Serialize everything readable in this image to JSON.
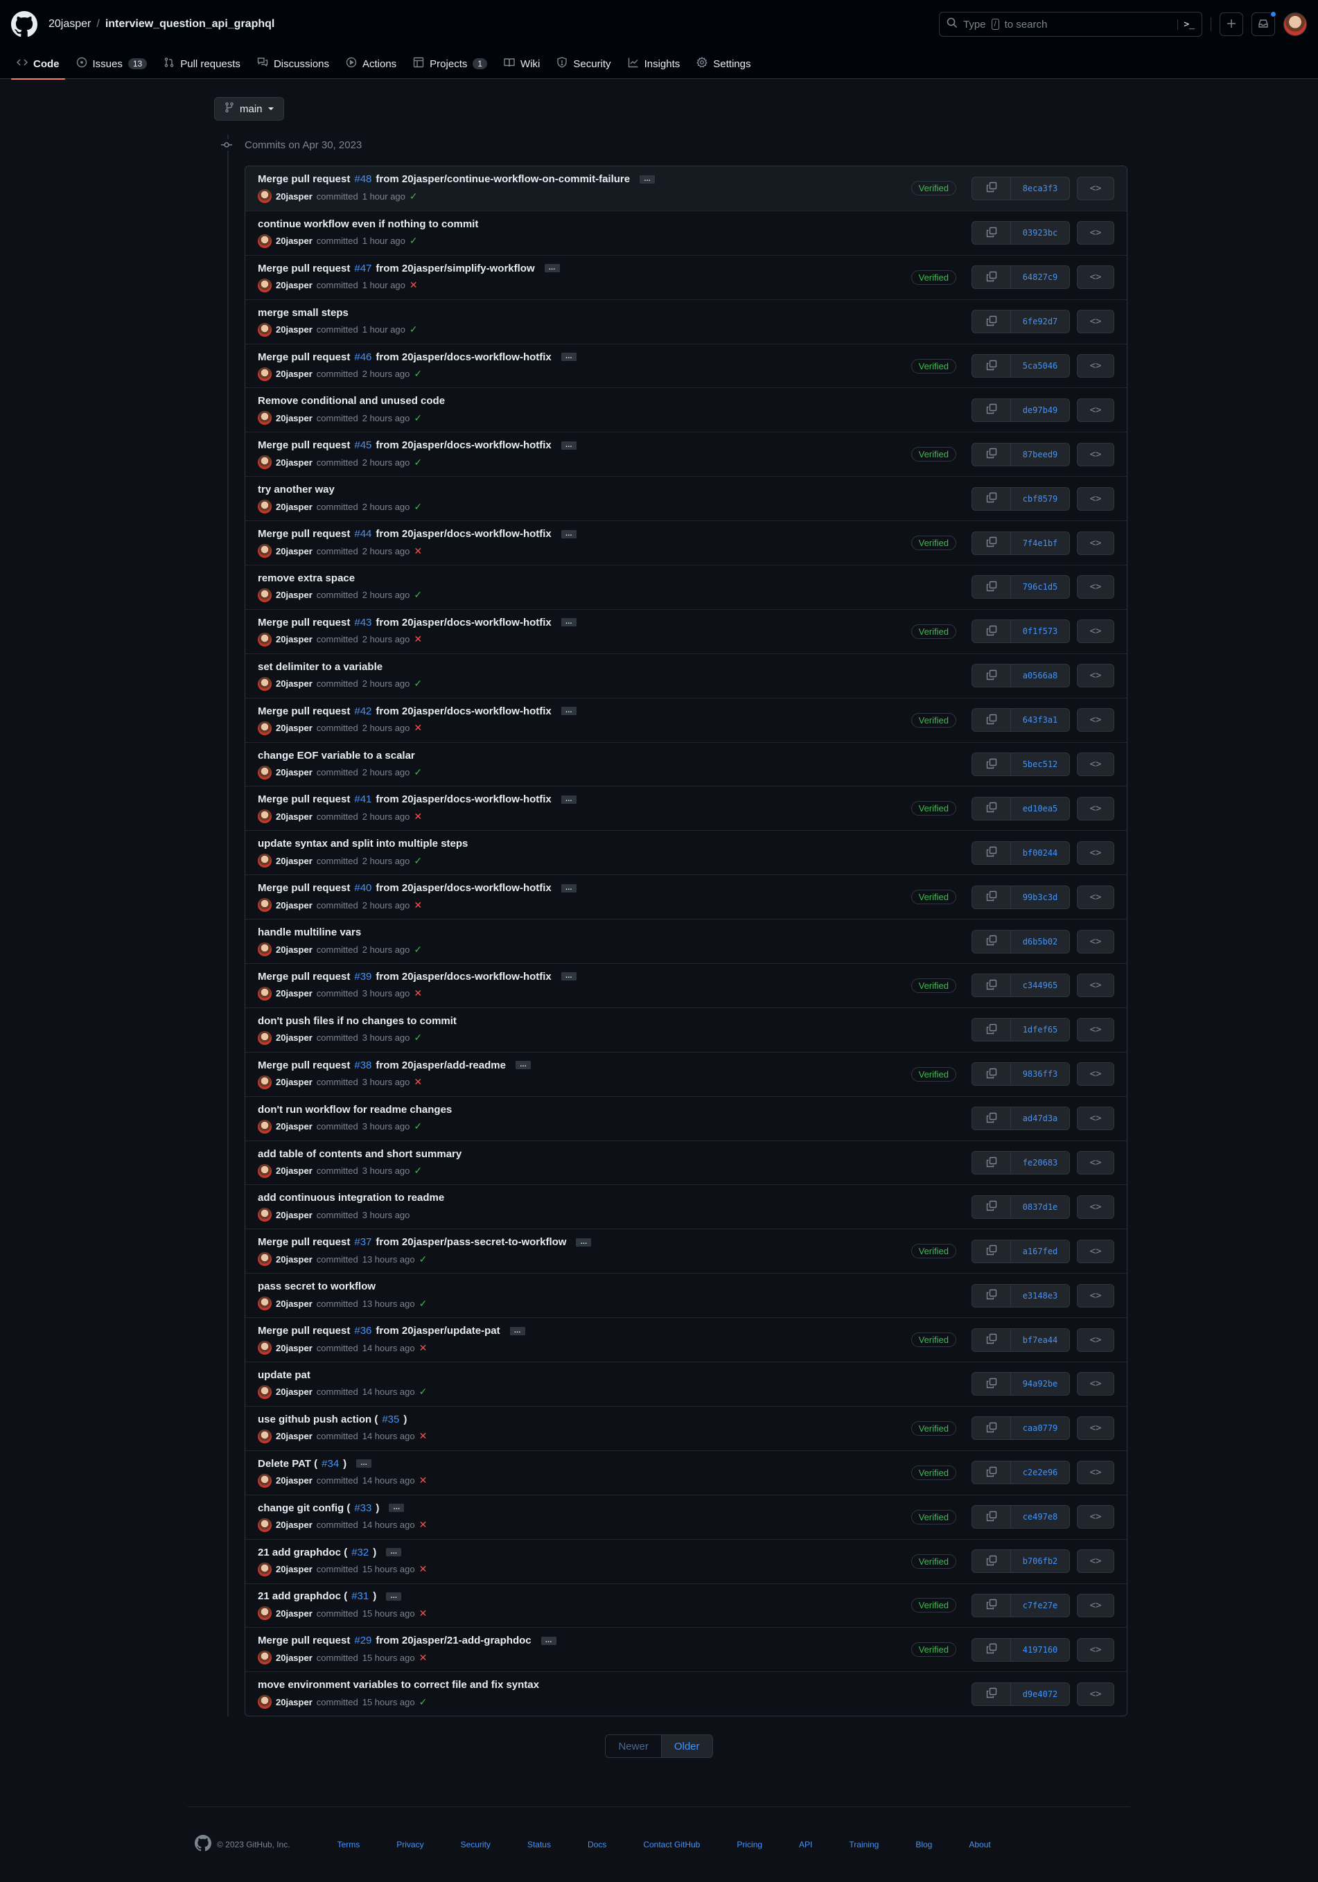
{
  "header": {
    "owner": "20jasper",
    "separator": "/",
    "repo": "interview_question_api_graphql",
    "search_placeholder_pre": "Type",
    "search_key": "/",
    "search_placeholder_post": "to search",
    "command_palette": ">_"
  },
  "nav": {
    "items": [
      {
        "label": "Code",
        "icon": "code-icon",
        "active": true
      },
      {
        "label": "Issues",
        "icon": "issue-icon",
        "count": "13"
      },
      {
        "label": "Pull requests",
        "icon": "pull-request-icon"
      },
      {
        "label": "Discussions",
        "icon": "discussion-icon"
      },
      {
        "label": "Actions",
        "icon": "play-icon"
      },
      {
        "label": "Projects",
        "icon": "table-icon",
        "count": "1"
      },
      {
        "label": "Wiki",
        "icon": "book-icon"
      },
      {
        "label": "Security",
        "icon": "shield-icon"
      },
      {
        "label": "Insights",
        "icon": "graph-icon"
      },
      {
        "label": "Settings",
        "icon": "gear-icon"
      }
    ]
  },
  "branch": {
    "name": "main"
  },
  "commits_group": {
    "date_label": "Commits on Apr 30, 2023",
    "verified_label": "Verified",
    "committed_label": "committed",
    "commits": [
      {
        "title_pre": "Merge pull request",
        "pr": "#48",
        "title_post": "from 20jasper/continue-workflow-on-commit-failure",
        "expand": true,
        "author": "20jasper",
        "time": "1 hour ago",
        "status": "success",
        "verified": true,
        "sha": "8eca3f3"
      },
      {
        "title_pre": "continue workflow even if nothing to commit",
        "pr": "",
        "title_post": "",
        "expand": false,
        "author": "20jasper",
        "time": "1 hour ago",
        "status": "success",
        "verified": false,
        "sha": "03923bc"
      },
      {
        "title_pre": "Merge pull request",
        "pr": "#47",
        "title_post": "from 20jasper/simplify-workflow",
        "expand": true,
        "author": "20jasper",
        "time": "1 hour ago",
        "status": "failure",
        "verified": true,
        "sha": "64827c9"
      },
      {
        "title_pre": "merge small steps",
        "pr": "",
        "title_post": "",
        "expand": false,
        "author": "20jasper",
        "time": "1 hour ago",
        "status": "success",
        "verified": false,
        "sha": "6fe92d7"
      },
      {
        "title_pre": "Merge pull request",
        "pr": "#46",
        "title_post": "from 20jasper/docs-workflow-hotfix",
        "expand": true,
        "author": "20jasper",
        "time": "2 hours ago",
        "status": "success",
        "verified": true,
        "sha": "5ca5046"
      },
      {
        "title_pre": "Remove conditional and unused code",
        "pr": "",
        "title_post": "",
        "expand": false,
        "author": "20jasper",
        "time": "2 hours ago",
        "status": "success",
        "verified": false,
        "sha": "de97b49"
      },
      {
        "title_pre": "Merge pull request",
        "pr": "#45",
        "title_post": "from 20jasper/docs-workflow-hotfix",
        "expand": true,
        "author": "20jasper",
        "time": "2 hours ago",
        "status": "success",
        "verified": true,
        "sha": "87beed9"
      },
      {
        "title_pre": "try another way",
        "pr": "",
        "title_post": "",
        "expand": false,
        "author": "20jasper",
        "time": "2 hours ago",
        "status": "success",
        "verified": false,
        "sha": "cbf8579"
      },
      {
        "title_pre": "Merge pull request",
        "pr": "#44",
        "title_post": "from 20jasper/docs-workflow-hotfix",
        "expand": true,
        "author": "20jasper",
        "time": "2 hours ago",
        "status": "failure",
        "verified": true,
        "sha": "7f4e1bf"
      },
      {
        "title_pre": "remove extra space",
        "pr": "",
        "title_post": "",
        "expand": false,
        "author": "20jasper",
        "time": "2 hours ago",
        "status": "success",
        "verified": false,
        "sha": "796c1d5"
      },
      {
        "title_pre": "Merge pull request",
        "pr": "#43",
        "title_post": "from 20jasper/docs-workflow-hotfix",
        "expand": true,
        "author": "20jasper",
        "time": "2 hours ago",
        "status": "failure",
        "verified": true,
        "sha": "0f1f573"
      },
      {
        "title_pre": "set delimiter to a variable",
        "pr": "",
        "title_post": "",
        "expand": false,
        "author": "20jasper",
        "time": "2 hours ago",
        "status": "success",
        "verified": false,
        "sha": "a0566a8"
      },
      {
        "title_pre": "Merge pull request",
        "pr": "#42",
        "title_post": "from 20jasper/docs-workflow-hotfix",
        "expand": true,
        "author": "20jasper",
        "time": "2 hours ago",
        "status": "failure",
        "verified": true,
        "sha": "643f3a1"
      },
      {
        "title_pre": "change EOF variable to a scalar",
        "pr": "",
        "title_post": "",
        "expand": false,
        "author": "20jasper",
        "time": "2 hours ago",
        "status": "success",
        "verified": false,
        "sha": "5bec512"
      },
      {
        "title_pre": "Merge pull request",
        "pr": "#41",
        "title_post": "from 20jasper/docs-workflow-hotfix",
        "expand": true,
        "author": "20jasper",
        "time": "2 hours ago",
        "status": "failure",
        "verified": true,
        "sha": "ed10ea5"
      },
      {
        "title_pre": "update syntax and split into multiple steps",
        "pr": "",
        "title_post": "",
        "expand": false,
        "author": "20jasper",
        "time": "2 hours ago",
        "status": "success",
        "verified": false,
        "sha": "bf00244"
      },
      {
        "title_pre": "Merge pull request",
        "pr": "#40",
        "title_post": "from 20jasper/docs-workflow-hotfix",
        "expand": true,
        "author": "20jasper",
        "time": "2 hours ago",
        "status": "failure",
        "verified": true,
        "sha": "99b3c3d"
      },
      {
        "title_pre": "handle multiline vars",
        "pr": "",
        "title_post": "",
        "expand": false,
        "author": "20jasper",
        "time": "2 hours ago",
        "status": "success",
        "verified": false,
        "sha": "d6b5b02"
      },
      {
        "title_pre": "Merge pull request",
        "pr": "#39",
        "title_post": "from 20jasper/docs-workflow-hotfix",
        "expand": true,
        "author": "20jasper",
        "time": "3 hours ago",
        "status": "failure",
        "verified": true,
        "sha": "c344965"
      },
      {
        "title_pre": "don't push files if no changes to commit",
        "pr": "",
        "title_post": "",
        "expand": false,
        "author": "20jasper",
        "time": "3 hours ago",
        "status": "success",
        "verified": false,
        "sha": "1dfef65"
      },
      {
        "title_pre": "Merge pull request",
        "pr": "#38",
        "title_post": "from 20jasper/add-readme",
        "expand": true,
        "author": "20jasper",
        "time": "3 hours ago",
        "status": "failure",
        "verified": true,
        "sha": "9836ff3"
      },
      {
        "title_pre": "don't run workflow for readme changes",
        "pr": "",
        "title_post": "",
        "expand": false,
        "author": "20jasper",
        "time": "3 hours ago",
        "status": "success",
        "verified": false,
        "sha": "ad47d3a"
      },
      {
        "title_pre": "add table of contents and short summary",
        "pr": "",
        "title_post": "",
        "expand": false,
        "author": "20jasper",
        "time": "3 hours ago",
        "status": "success",
        "verified": false,
        "sha": "fe20683"
      },
      {
        "title_pre": "add continuous integration to readme",
        "pr": "",
        "title_post": "",
        "expand": false,
        "author": "20jasper",
        "time": "3 hours ago",
        "status": "none",
        "verified": false,
        "sha": "0837d1e"
      },
      {
        "title_pre": "Merge pull request",
        "pr": "#37",
        "title_post": "from 20jasper/pass-secret-to-workflow",
        "expand": true,
        "author": "20jasper",
        "time": "13 hours ago",
        "status": "success",
        "verified": true,
        "sha": "a167fed"
      },
      {
        "title_pre": "pass secret to workflow",
        "pr": "",
        "title_post": "",
        "expand": false,
        "author": "20jasper",
        "time": "13 hours ago",
        "status": "success",
        "verified": false,
        "sha": "e3148e3"
      },
      {
        "title_pre": "Merge pull request",
        "pr": "#36",
        "title_post": "from 20jasper/update-pat",
        "expand": true,
        "author": "20jasper",
        "time": "14 hours ago",
        "status": "failure",
        "verified": true,
        "sha": "bf7ea44"
      },
      {
        "title_pre": "update pat",
        "pr": "",
        "title_post": "",
        "expand": false,
        "author": "20jasper",
        "time": "14 hours ago",
        "status": "success",
        "verified": false,
        "sha": "94a92be"
      },
      {
        "title_pre": "use github push action (",
        "pr": "#35",
        "title_post": ")",
        "expand": false,
        "author": "20jasper",
        "time": "14 hours ago",
        "status": "failure",
        "verified": true,
        "sha": "caa0779"
      },
      {
        "title_pre": "Delete PAT (",
        "pr": "#34",
        "title_post": ")",
        "expand": true,
        "author": "20jasper",
        "time": "14 hours ago",
        "status": "failure",
        "verified": true,
        "sha": "c2e2e96"
      },
      {
        "title_pre": "change git config (",
        "pr": "#33",
        "title_post": ")",
        "expand": true,
        "author": "20jasper",
        "time": "14 hours ago",
        "status": "failure",
        "verified": true,
        "sha": "ce497e8"
      },
      {
        "title_pre": "21 add graphdoc (",
        "pr": "#32",
        "title_post": ")",
        "expand": true,
        "author": "20jasper",
        "time": "15 hours ago",
        "status": "failure",
        "verified": true,
        "sha": "b706fb2"
      },
      {
        "title_pre": "21 add graphdoc (",
        "pr": "#31",
        "title_post": ")",
        "expand": true,
        "author": "20jasper",
        "time": "15 hours ago",
        "status": "failure",
        "verified": true,
        "sha": "c7fe27e"
      },
      {
        "title_pre": "Merge pull request",
        "pr": "#29",
        "title_post": "from 20jasper/21-add-graphdoc",
        "expand": true,
        "author": "20jasper",
        "time": "15 hours ago",
        "status": "failure",
        "verified": true,
        "sha": "4197160"
      },
      {
        "title_pre": "move environment variables to correct file and fix syntax",
        "pr": "",
        "title_post": "",
        "expand": false,
        "author": "20jasper",
        "time": "15 hours ago",
        "status": "success",
        "verified": false,
        "sha": "d9e4072"
      }
    ]
  },
  "pagination": {
    "newer": "Newer",
    "older": "Older"
  },
  "footer": {
    "copyright": "© 2023 GitHub, Inc.",
    "links": [
      "Terms",
      "Privacy",
      "Security",
      "Status",
      "Docs",
      "Contact GitHub",
      "Pricing",
      "API",
      "Training",
      "Blog",
      "About"
    ]
  },
  "colors": {
    "accent": "#4493f8",
    "success": "#3fb950",
    "failure": "#f85149",
    "active_tab_underline": "#f78166"
  }
}
